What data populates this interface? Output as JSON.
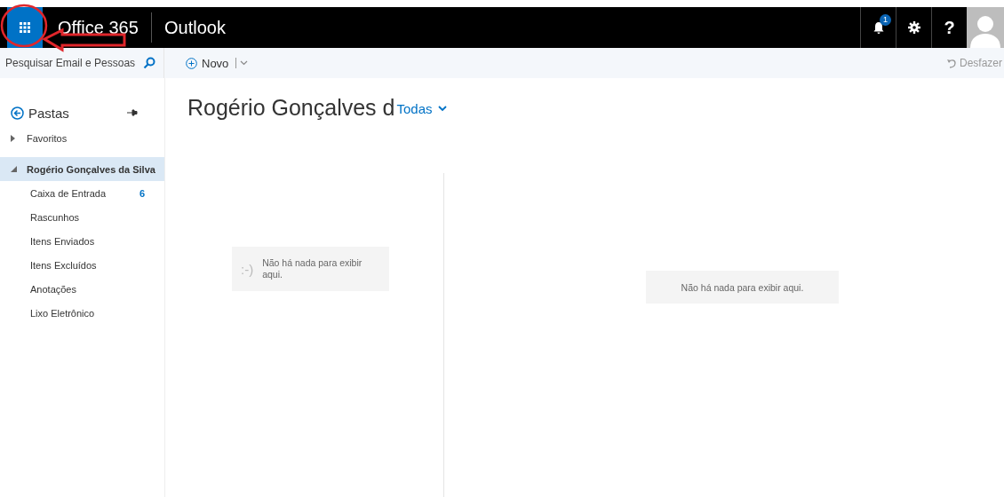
{
  "header": {
    "app_name": "Office 365",
    "module": "Outlook",
    "notification_count": "1",
    "help": "?"
  },
  "toolbar": {
    "search_placeholder": "Pesquisar Email e Pessoas",
    "new_button": "Novo",
    "undo_button": "Desfazer"
  },
  "sidebar": {
    "title": "Pastas",
    "tree": [
      {
        "label": "Favoritos",
        "expanded": false,
        "selected": false
      },
      {
        "label": "Rogério Gonçalves da Silva",
        "expanded": true,
        "selected": true,
        "children": [
          {
            "label": "Caixa de Entrada",
            "count": "6",
            "selected": false
          },
          {
            "label": "Rascunhos",
            "selected": false
          },
          {
            "label": "Itens Enviados",
            "selected": false
          },
          {
            "label": "Itens Excluídos",
            "selected": false
          },
          {
            "label": "Anotações",
            "selected": false
          },
          {
            "label": "Lixo Eletrônico",
            "selected": false
          }
        ]
      }
    ]
  },
  "message_list": {
    "title": "Rogério Gonçalves d",
    "filter": "Todas",
    "empty_emoticon": ":-)",
    "empty_message": "Não há nada para exibir aqui."
  },
  "reading_pane": {
    "empty_message": "Não há nada para exibir aqui."
  }
}
